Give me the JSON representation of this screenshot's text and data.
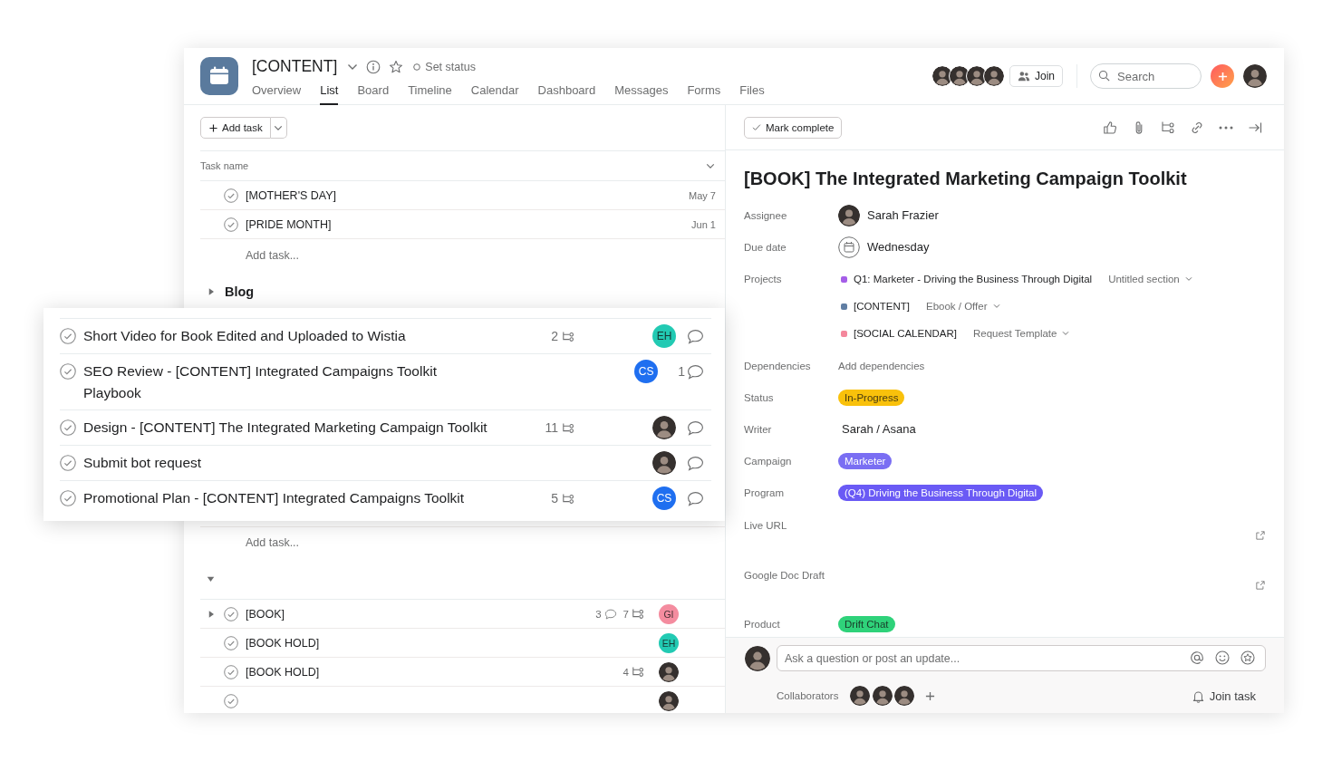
{
  "header": {
    "title": "[CONTENT]",
    "status_button": "Set status",
    "tabs": [
      {
        "label": "Overview",
        "selected": false
      },
      {
        "label": "List",
        "selected": true
      },
      {
        "label": "Board",
        "selected": false
      },
      {
        "label": "Timeline",
        "selected": false
      },
      {
        "label": "Calendar",
        "selected": false
      },
      {
        "label": "Dashboard",
        "selected": false
      },
      {
        "label": "Messages",
        "selected": false
      },
      {
        "label": "Forms",
        "selected": false
      },
      {
        "label": "Files",
        "selected": false
      }
    ],
    "members": [
      {
        "kind": "photo"
      },
      {
        "kind": "photo"
      },
      {
        "kind": "photo"
      },
      {
        "kind": "photo"
      }
    ],
    "join_button": "Join",
    "search": {
      "placeholder": "Search"
    },
    "user": {
      "kind": "photo"
    }
  },
  "list": {
    "add_task_button": "Add task",
    "column_header": "Task name",
    "upper": [
      {
        "kind": "task",
        "name": "[MOTHER'S DAY]",
        "completed": false,
        "due": "May 7"
      },
      {
        "kind": "task",
        "name": "[PRIDE MONTH]",
        "completed": false,
        "due": "Jun 1"
      },
      {
        "kind": "add",
        "label": "Add task..."
      },
      {
        "kind": "section",
        "name": "Blog",
        "expanded": false
      }
    ],
    "lower": [
      {
        "kind": "add",
        "label": "Add task..."
      },
      {
        "kind": "section",
        "expanded": true
      },
      {
        "kind": "task",
        "name": "[BOOK]",
        "expandable": true,
        "completed": false,
        "comments": "3",
        "subtasks": "7",
        "assignee": {
          "kind": "initials",
          "initials": "GI",
          "color": "#f48c9f"
        }
      },
      {
        "kind": "task",
        "name": "[BOOK HOLD]",
        "completed": false,
        "assignee": {
          "kind": "initials",
          "initials": "EH",
          "color": "#22cab3"
        }
      },
      {
        "kind": "task",
        "name": "[BOOK HOLD]",
        "completed": false,
        "subtasks": "4",
        "assignee": {
          "kind": "photo"
        }
      },
      {
        "kind": "task",
        "completed": false,
        "assignee": {
          "kind": "photo"
        }
      }
    ]
  },
  "highlight_card": {
    "tasks": [
      {
        "name": "Short Video for Book Edited and Uploaded to Wistia",
        "completed": false,
        "subtasks": "2",
        "assignee": {
          "kind": "initials",
          "initials": "EH",
          "color": "#22cab3"
        }
      },
      {
        "name": "SEO Review - [CONTENT] Integrated Campaigns Toolkit Playbook",
        "completed": false,
        "comments": "1",
        "assignee": {
          "kind": "initials",
          "initials": "CS",
          "color": "#1f6ff0"
        }
      },
      {
        "name": "Design - [CONTENT] The Integrated Marketing Campaign Toolkit",
        "completed": false,
        "subtasks": "11",
        "assignee": {
          "kind": "photo"
        }
      },
      {
        "name": "Submit bot request",
        "completed": false,
        "assignee": {
          "kind": "photo"
        }
      },
      {
        "name": "Promotional Plan - [CONTENT] Integrated Campaigns Toolkit",
        "completed": false,
        "subtasks": "5",
        "assignee": {
          "kind": "initials",
          "initials": "CS",
          "color": "#1f6ff0"
        }
      }
    ]
  },
  "detail": {
    "mark_complete": "Mark complete",
    "title": "[BOOK] The Integrated Marketing Campaign Toolkit",
    "fields": [
      {
        "kind": "person",
        "label": "Assignee",
        "value": "Sarah Frazier",
        "avatar": {
          "kind": "photo"
        }
      },
      {
        "kind": "date",
        "label": "Due date",
        "value": "Wednesday"
      },
      {
        "kind": "projects",
        "label": "Projects",
        "projects": [
          {
            "name": "Q1: Marketer - Driving the Business Through Digital",
            "color": "#a55ee8",
            "section": "Untitled section"
          },
          {
            "name": "[CONTENT]",
            "color": "#607ea3",
            "section": "Ebook / Offer"
          },
          {
            "name": "[SOCIAL CALENDAR]",
            "color": "#f4879c",
            "section": "Request Template"
          }
        ]
      },
      {
        "kind": "action",
        "label": "Dependencies",
        "value": "Add dependencies"
      },
      {
        "kind": "pill",
        "label": "Status",
        "value": "In-Progress",
        "color": "#f9c10b"
      },
      {
        "kind": "text",
        "label": "Writer",
        "value": "Sarah / Asana"
      },
      {
        "kind": "pill",
        "label": "Campaign",
        "value": "Marketer",
        "color": "#7a6ef3"
      },
      {
        "kind": "pill",
        "label": "Program",
        "value": "(Q4) Driving the Business Through Digital",
        "color": "#6a5af5"
      },
      {
        "kind": "url",
        "label": "Live URL"
      },
      {
        "kind": "url",
        "label": "Google Doc Draft"
      },
      {
        "kind": "pill",
        "label": "Product",
        "value": "Drift Chat",
        "color": "#2fd27a"
      }
    ],
    "composer": {
      "avatar": {
        "kind": "photo"
      },
      "placeholder": "Ask a question or post an update..."
    },
    "collaborators": {
      "label": "Collaborators",
      "people": [
        {
          "kind": "photo"
        },
        {
          "kind": "photo"
        },
        {
          "kind": "photo"
        }
      ]
    },
    "join_task": "Join task"
  }
}
